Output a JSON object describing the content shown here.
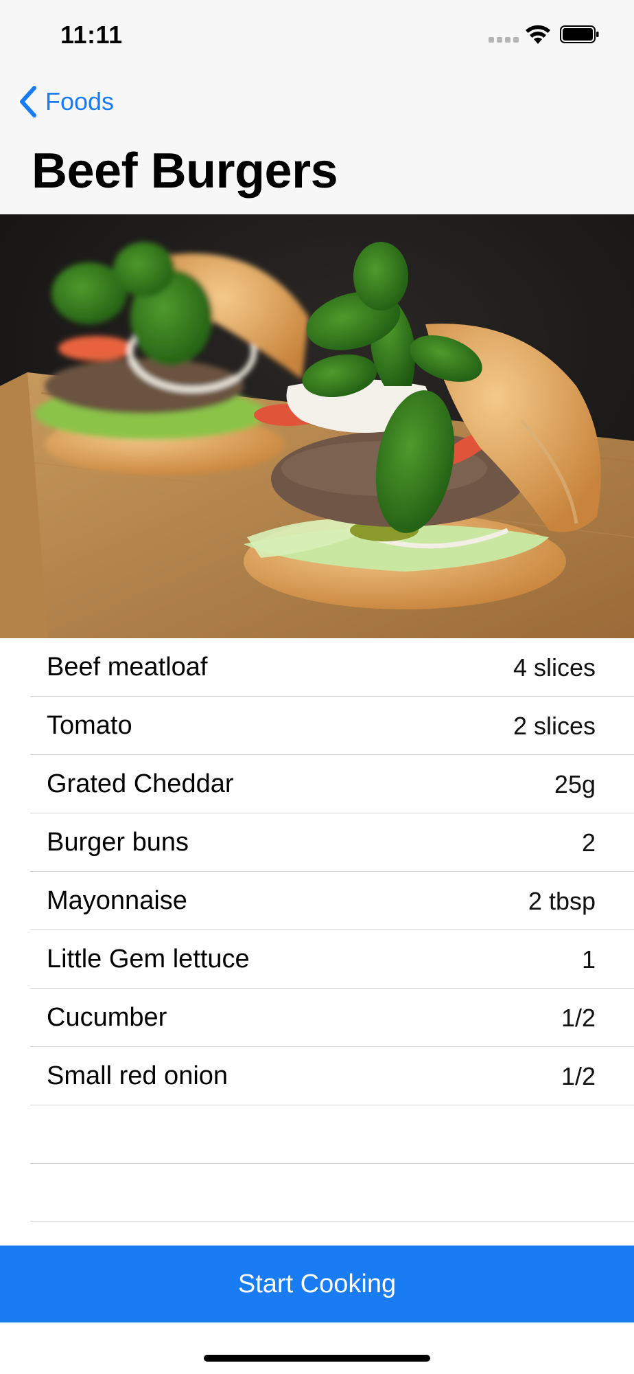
{
  "status_bar": {
    "time": "11:11"
  },
  "nav": {
    "back_label": "Foods",
    "title": "Beef Burgers"
  },
  "hero_image": {
    "subject": "two burgers with basil, tomato, mozzarella and lettuce on a wooden board"
  },
  "ingredients": [
    {
      "name": "Beef meatloaf",
      "quantity": "4 slices"
    },
    {
      "name": "Tomato",
      "quantity": "2 slices"
    },
    {
      "name": "Grated Cheddar",
      "quantity": "25g"
    },
    {
      "name": "Burger buns",
      "quantity": "2"
    },
    {
      "name": "Mayonnaise",
      "quantity": "2 tbsp"
    },
    {
      "name": "Little Gem lettuce",
      "quantity": "1"
    },
    {
      "name": "Cucumber",
      "quantity": "1/2"
    },
    {
      "name": "Small red onion",
      "quantity": "1/2"
    }
  ],
  "actions": {
    "start_label": "Start Cooking"
  },
  "colors": {
    "accent": "#1a7cf2",
    "nav_background": "#f7f7f7",
    "separator": "#d1d1d6"
  }
}
